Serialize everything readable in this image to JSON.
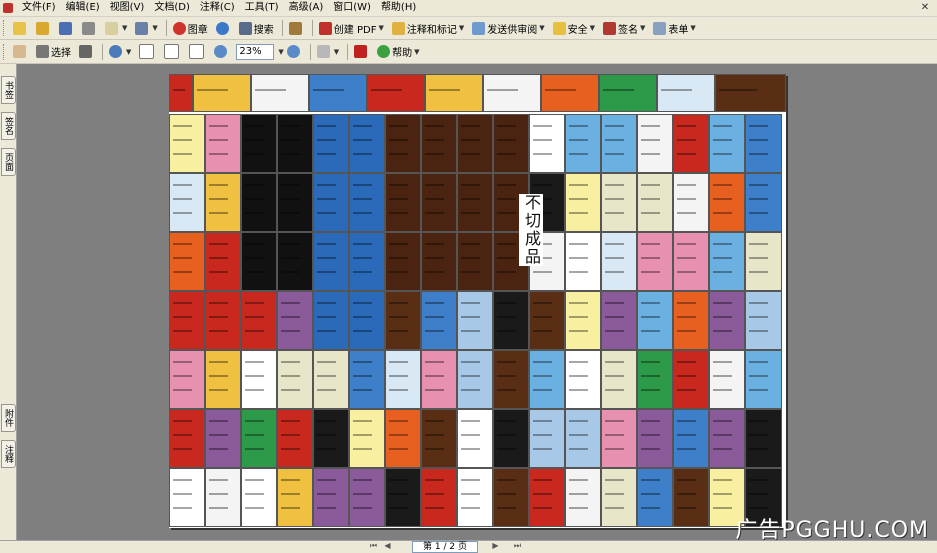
{
  "menu": [
    "文件(F)",
    "编辑(E)",
    "视图(V)",
    "文档(D)",
    "注释(C)",
    "工具(T)",
    "高级(A)",
    "窗口(W)",
    "帮助(H)"
  ],
  "toolbar1": {
    "picture_label": "图章",
    "search_label": "搜索",
    "create_pdf_label": "创建 PDF",
    "comment_label": "注释和标记",
    "review_label": "发送供审阅",
    "security_label": "安全",
    "sign_label": "签名",
    "forms_label": "表单"
  },
  "toolbar2": {
    "select_label": "选择",
    "zoom_value": "23%",
    "help_label": "帮助"
  },
  "left_tabs": [
    "书签",
    "签名",
    "页面",
    "附件",
    "注释"
  ],
  "status": {
    "page_indicator": "第 1 / 2 页"
  },
  "watermark": "广告PGGHU.COM",
  "banner_text": "不切成品",
  "colors": {
    "chrome": "#ece9d8",
    "workspace": "#7f7f7f",
    "accent_red": "#c0302a"
  }
}
